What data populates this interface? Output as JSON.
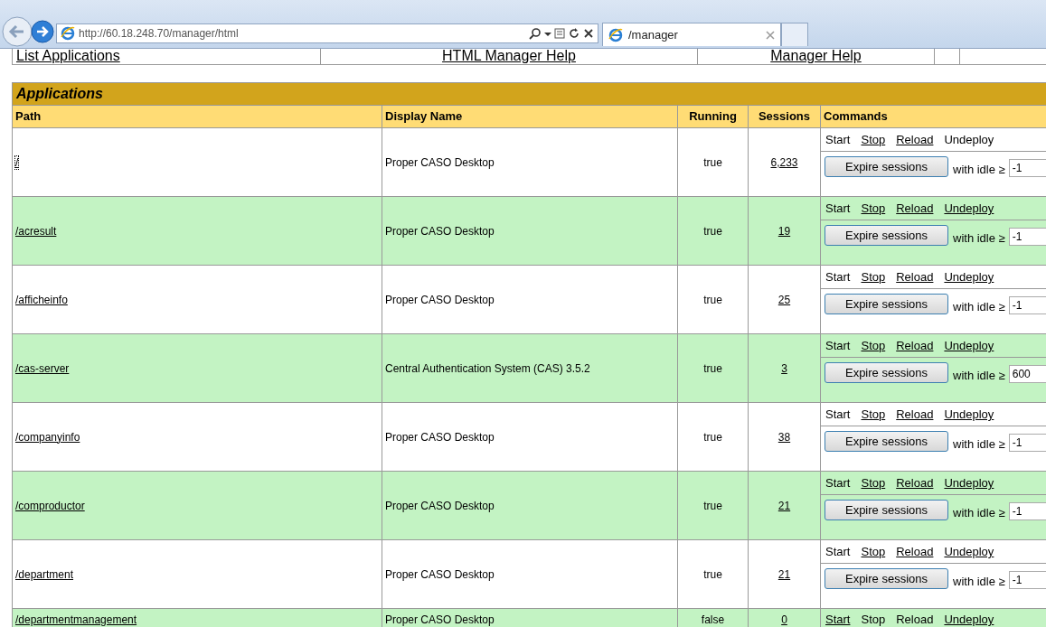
{
  "browser": {
    "address": "http://60.18.248.70/manager/html",
    "tab_title": "/manager"
  },
  "nav_links": [
    "List Applications",
    "HTML Manager Help",
    "Manager Help"
  ],
  "applications": {
    "title": "Applications",
    "columns": [
      "Path",
      "Display Name",
      "Running",
      "Sessions",
      "Commands"
    ],
    "rows": [
      {
        "path": "/",
        "focused": true,
        "display_name": "Proper CASO Desktop",
        "running": "true",
        "sessions": "6,233",
        "commands": [
          {
            "label": "Start",
            "enabled": false
          },
          {
            "label": "Stop",
            "enabled": true
          },
          {
            "label": "Reload",
            "enabled": true
          },
          {
            "label": "Undeploy",
            "enabled": false
          }
        ],
        "expire_button": "Expire sessions",
        "idle_label": "with idle ≥",
        "idle_value": "-1"
      },
      {
        "path": "/acresult",
        "focused": false,
        "display_name": "Proper CASO Desktop",
        "running": "true",
        "sessions": "19",
        "commands": [
          {
            "label": "Start",
            "enabled": false
          },
          {
            "label": "Stop",
            "enabled": true
          },
          {
            "label": "Reload",
            "enabled": true
          },
          {
            "label": "Undeploy",
            "enabled": true
          }
        ],
        "expire_button": "Expire sessions",
        "idle_label": "with idle ≥",
        "idle_value": "-1"
      },
      {
        "path": "/afficheinfo",
        "focused": false,
        "display_name": "Proper CASO Desktop",
        "running": "true",
        "sessions": "25",
        "commands": [
          {
            "label": "Start",
            "enabled": false
          },
          {
            "label": "Stop",
            "enabled": true
          },
          {
            "label": "Reload",
            "enabled": true
          },
          {
            "label": "Undeploy",
            "enabled": true
          }
        ],
        "expire_button": "Expire sessions",
        "idle_label": "with idle ≥",
        "idle_value": "-1"
      },
      {
        "path": "/cas-server",
        "focused": false,
        "display_name": "Central Authentication System (CAS) 3.5.2",
        "running": "true",
        "sessions": "3",
        "commands": [
          {
            "label": "Start",
            "enabled": false
          },
          {
            "label": "Stop",
            "enabled": true
          },
          {
            "label": "Reload",
            "enabled": true
          },
          {
            "label": "Undeploy",
            "enabled": true
          }
        ],
        "expire_button": "Expire sessions",
        "idle_label": "with idle ≥",
        "idle_value": "600"
      },
      {
        "path": "/companyinfo",
        "focused": false,
        "display_name": "Proper CASO Desktop",
        "running": "true",
        "sessions": "38",
        "commands": [
          {
            "label": "Start",
            "enabled": false
          },
          {
            "label": "Stop",
            "enabled": true
          },
          {
            "label": "Reload",
            "enabled": true
          },
          {
            "label": "Undeploy",
            "enabled": true
          }
        ],
        "expire_button": "Expire sessions",
        "idle_label": "with idle ≥",
        "idle_value": "-1"
      },
      {
        "path": "/comproductor",
        "focused": false,
        "display_name": "Proper CASO Desktop",
        "running": "true",
        "sessions": "21",
        "commands": [
          {
            "label": "Start",
            "enabled": false
          },
          {
            "label": "Stop",
            "enabled": true
          },
          {
            "label": "Reload",
            "enabled": true
          },
          {
            "label": "Undeploy",
            "enabled": true
          }
        ],
        "expire_button": "Expire sessions",
        "idle_label": "with idle ≥",
        "idle_value": "-1"
      },
      {
        "path": "/department",
        "focused": false,
        "display_name": "Proper CASO Desktop",
        "running": "true",
        "sessions": "21",
        "commands": [
          {
            "label": "Start",
            "enabled": false
          },
          {
            "label": "Stop",
            "enabled": true
          },
          {
            "label": "Reload",
            "enabled": true
          },
          {
            "label": "Undeploy",
            "enabled": true
          }
        ],
        "expire_button": "Expire sessions",
        "idle_label": "with idle ≥",
        "idle_value": "-1"
      },
      {
        "path": "/departmentmanagement",
        "focused": false,
        "display_name": "Proper CASO Desktop",
        "running": "false",
        "sessions": "0",
        "commands": [
          {
            "label": "Start",
            "enabled": true
          },
          {
            "label": "Stop",
            "enabled": false
          },
          {
            "label": "Reload",
            "enabled": false
          },
          {
            "label": "Undeploy",
            "enabled": true
          }
        ]
      }
    ]
  }
}
